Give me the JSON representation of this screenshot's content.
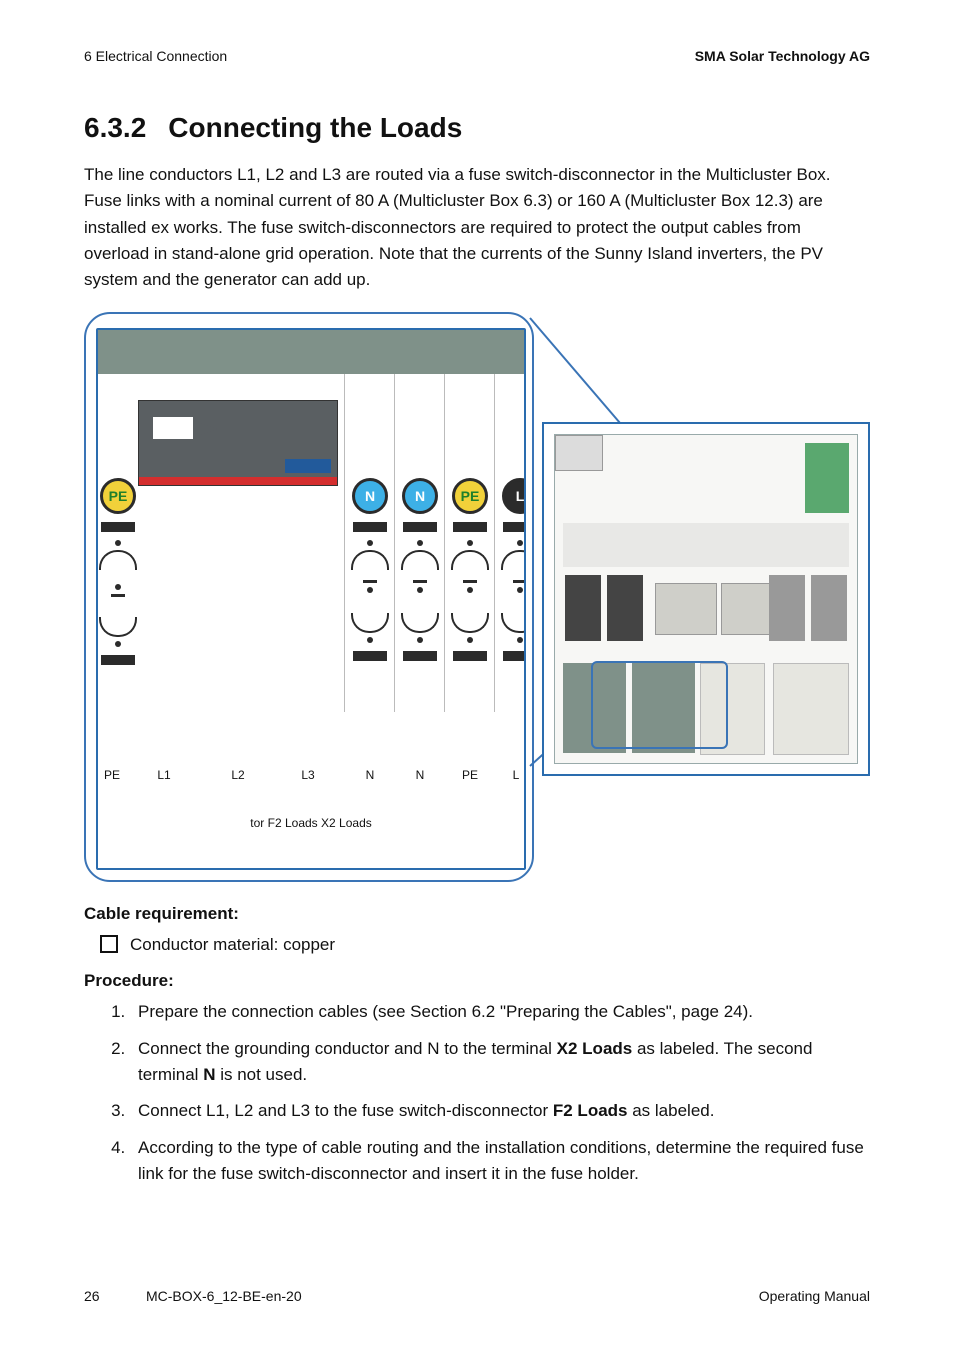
{
  "header": {
    "left": "6  Electrical Connection",
    "right": "SMA Solar Technology AG"
  },
  "section": {
    "number": "6.3.2",
    "title": "Connecting the Loads"
  },
  "intro": "The line conductors L1, L2 and L3 are routed via a fuse switch-disconnector in the Multicluster Box. Fuse links with a nominal current of 80 A (Multicluster Box 6.3) or 160 A (Multicluster Box 12.3) are installed ex works. The fuse switch-disconnectors are required to protect the output cables from overload in stand-alone grid operation. Note that the currents of the Sunny Island inverters, the PV system and the generator can add up.",
  "figure": {
    "term_labels": {
      "pe": "PE",
      "n": "N",
      "l": "L"
    },
    "bottom_labels": {
      "pe1": "PE",
      "l1": "L1",
      "l2": "L2",
      "l3": "L3",
      "n1": "N",
      "n2": "N",
      "pe2": "PE",
      "l_partial": "L",
      "tor": "tor"
    },
    "captions": {
      "f2a": "F2",
      "f2b": "Loads",
      "x2a": "X2",
      "x2b": "Loads"
    }
  },
  "cable_req": {
    "heading": "Cable requirement:",
    "items": [
      "Conductor material: copper"
    ]
  },
  "procedure": {
    "heading": "Procedure:",
    "steps": [
      {
        "pre": "Prepare the connection cables (see Section 6.2 \"Preparing the Cables\", page 24)."
      },
      {
        "pre": "Connect the grounding conductor and N to the terminal ",
        "b1": "X2 Loads",
        "mid": " as labeled. The second terminal ",
        "b2": "N",
        "post": " is not used."
      },
      {
        "pre": "Connect L1, L2 and L3 to the fuse switch-disconnector ",
        "b1": "F2 Loads",
        "post": " as labeled."
      },
      {
        "pre": "According to the type of cable routing and the installation conditions, determine the required fuse link for the fuse switch-disconnector and insert it in the fuse holder."
      }
    ]
  },
  "footer": {
    "page": "26",
    "doc": "MC-BOX-6_12-BE-en-20",
    "type": "Operating Manual"
  }
}
